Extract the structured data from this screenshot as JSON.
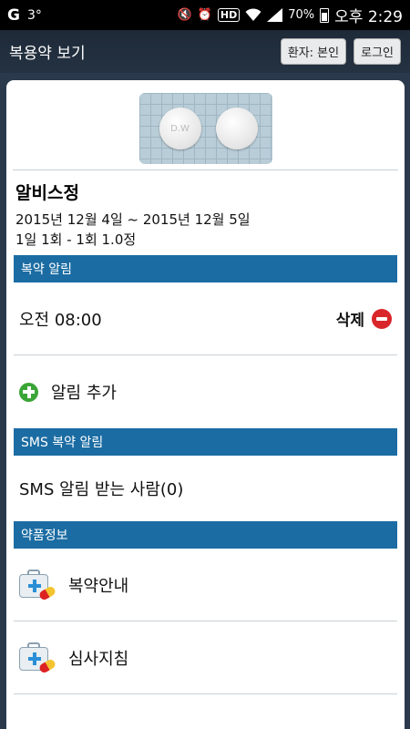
{
  "status_bar": {
    "left_app_icon": "G",
    "temperature": "3°",
    "hd": "HD",
    "battery": "70%",
    "time": "오후 2:29"
  },
  "header": {
    "title": "복용약 보기",
    "patient_button": "환자: 본인",
    "login_button": "로그인"
  },
  "drug": {
    "name": "알비스정",
    "period": "2015년 12월 4일 ~ 2015년 12월 5일",
    "dosage": "1일 1회 - 1회 1.0정",
    "pill_imprint": "D.W"
  },
  "alarm_section": {
    "header": "복약 알림",
    "alarm_time": "오전 08:00",
    "delete_label": "삭제",
    "add_label": "알림 추가"
  },
  "sms_section": {
    "header": "SMS 복약 알림",
    "recipients_label": "SMS 알림 받는 사람(0)"
  },
  "info_section": {
    "header": "약품정보",
    "items": [
      {
        "label": "복약안내",
        "icon": "medicine-kit-icon"
      },
      {
        "label": "심사지침",
        "icon": "medicine-kit-icon"
      }
    ]
  }
}
